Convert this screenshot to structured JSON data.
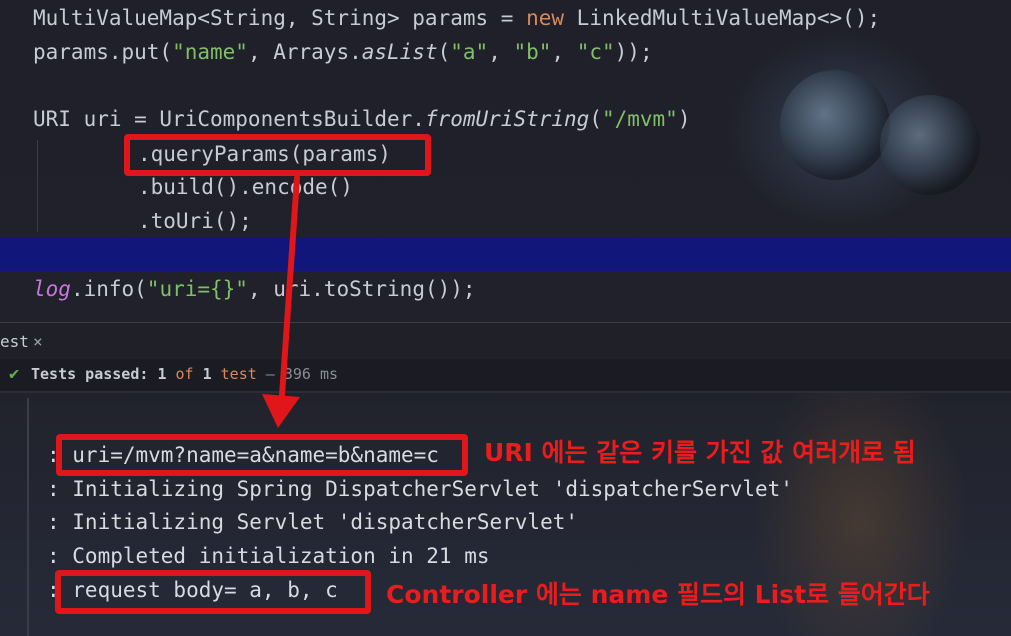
{
  "code": {
    "line1": {
      "type": "MultiValueMap<String, String> params = ",
      "kw": "new",
      "rest": " LinkedMultiValueMap<>();"
    },
    "line2": {
      "pre": "params.put(",
      "s1": "\"name\"",
      "mid": ", Arrays.",
      "fn": "asList",
      "open": "(",
      "s2": "\"a\"",
      "c1": ", ",
      "s3": "\"b\"",
      "c2": ", ",
      "s4": "\"c\"",
      "end": "));"
    },
    "line3": {
      "pre": "URI uri = UriComponentsBuilder.",
      "fn": "fromUriString",
      "open": "(",
      "s": "\"/mvm\"",
      "end": ")"
    },
    "line4": ".queryParams(params)",
    "line5": ".build().encode()",
    "line6": ".toUri();",
    "line7": {
      "log": "log",
      "mid": ".info(",
      "s": "\"uri={}\"",
      "end": ", uri.toString());"
    }
  },
  "tab": {
    "label": "est",
    "close": "×"
  },
  "status": {
    "check_icon": "check-icon",
    "prefix": "Tests passed: ",
    "n": "1",
    "of": " of ",
    "total": "1",
    "tail": " test",
    "time": " – 396 ms"
  },
  "console": [
    ": uri=/mvm?name=a&name=b&name=c",
    ": Initializing Spring DispatcherServlet 'dispatcherServlet'",
    ": Initializing Servlet 'dispatcherServlet'",
    ": Completed initialization in 21 ms",
    ": request body= a, b, c"
  ],
  "annotations": {
    "uri_note": "URI 에는 같은 키를 가진 값 여러개로 됨",
    "controller_note": "Controller 에는 name 필드의 List로 들어간다"
  },
  "colors": {
    "highlight_red": "#e0161a",
    "selection_band": "#10167a",
    "keyword": "#d8895b",
    "string": "#7fbf66",
    "pass_green": "#5fb544"
  }
}
